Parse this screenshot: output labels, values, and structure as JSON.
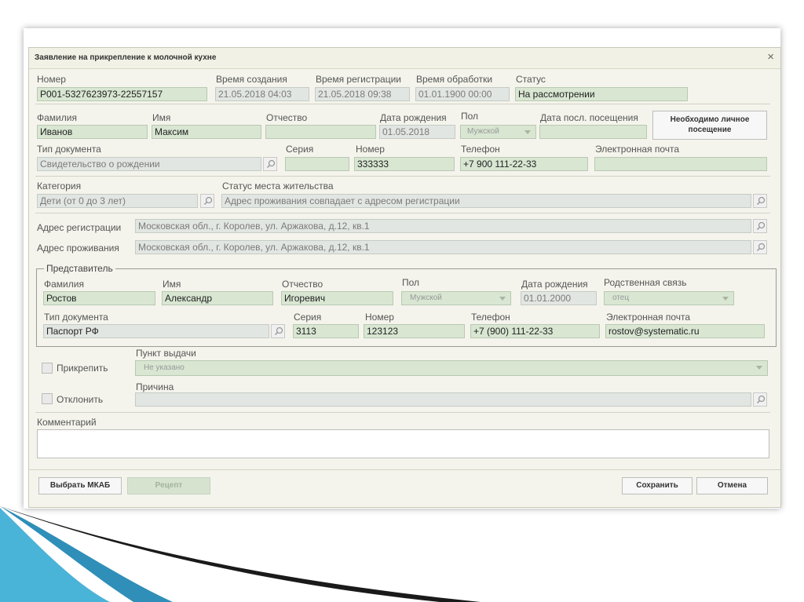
{
  "dialog": {
    "title": "Заявление на прикрепление к молочной кухне",
    "close": "×"
  },
  "top": {
    "number_label": "Номер",
    "number": "Р001-5327623973-22557157",
    "created_label": "Время создания",
    "created": "21.05.2018 04:03",
    "registered_label": "Время регистрации",
    "registered": "21.05.2018 09:38",
    "processed_label": "Время обработки",
    "processed": "01.01.1900 00:00",
    "status_label": "Статус",
    "status": "На рассмотрении"
  },
  "person": {
    "lastname_label": "Фамилия",
    "lastname": "Иванов",
    "firstname_label": "Имя",
    "firstname": "Максим",
    "patronymic_label": "Отчество",
    "patronymic": "",
    "birth_label": "Дата рождения",
    "birth": "01.05.2018",
    "gender_label": "Пол",
    "gender": "Мужской",
    "last_visit_label": "Дата посл. посещения",
    "last_visit": "",
    "visit_button": "Необходимо личное посещение",
    "doc_type_label": "Тип документа",
    "doc_type": "Свидетельство о рождении",
    "series_label": "Серия",
    "series": "",
    "doc_number_label": "Номер",
    "doc_number": "333333",
    "phone_label": "Телефон",
    "phone": "+7 900 111-22-33",
    "email_label": "Электронная почта",
    "email": ""
  },
  "category": {
    "category_label": "Категория",
    "category": "Дети (от 0 до 3 лет)",
    "residence_label": "Статус места жительства",
    "residence": "Адрес проживания совпадает с адресом регистрации"
  },
  "address": {
    "reg_label": "Адрес регистрации",
    "reg": "Московская обл., г. Королев, ул. Аржакова, д.12, кв.1",
    "live_label": "Адрес проживания",
    "live": "Московская обл., г. Королев, ул. Аржакова, д.12, кв.1"
  },
  "representative": {
    "legend": "Представитель",
    "lastname_label": "Фамилия",
    "lastname": "Ростов",
    "firstname_label": "Имя",
    "firstname": "Александр",
    "patronymic_label": "Отчество",
    "patronymic": "Игоревич",
    "gender_label": "Пол",
    "gender": "Мужской",
    "birth_label": "Дата рождения",
    "birth": "01.01.2000",
    "relation_label": "Родственная связь",
    "relation": "отец",
    "doc_type_label": "Тип документа",
    "doc_type": "Паспорт РФ",
    "series_label": "Серия",
    "series": "3113",
    "doc_number_label": "Номер",
    "doc_number": "123123",
    "phone_label": "Телефон",
    "phone": "+7 (900) 111-22-33",
    "email_label": "Электронная почта",
    "email": "rostov@systematic.ru"
  },
  "decision": {
    "attach_label": "Прикрепить",
    "point_label": "Пункт выдачи",
    "point": "Не указано",
    "reject_label": "Отклонить",
    "reason_label": "Причина",
    "reason": ""
  },
  "comment": {
    "label": "Комментарий",
    "value": ""
  },
  "buttons": {
    "select_mkab": "Выбрать МКАБ",
    "recipe": "Рецепт",
    "save": "Сохранить",
    "cancel": "Отмена"
  },
  "colors": {
    "field_green": "#d8e6d2",
    "field_gray": "#e2e6e2",
    "dialog_bg": "#f4f4ec",
    "deco_blue": "#3fa9d2",
    "deco_black": "#1a1a1a"
  }
}
